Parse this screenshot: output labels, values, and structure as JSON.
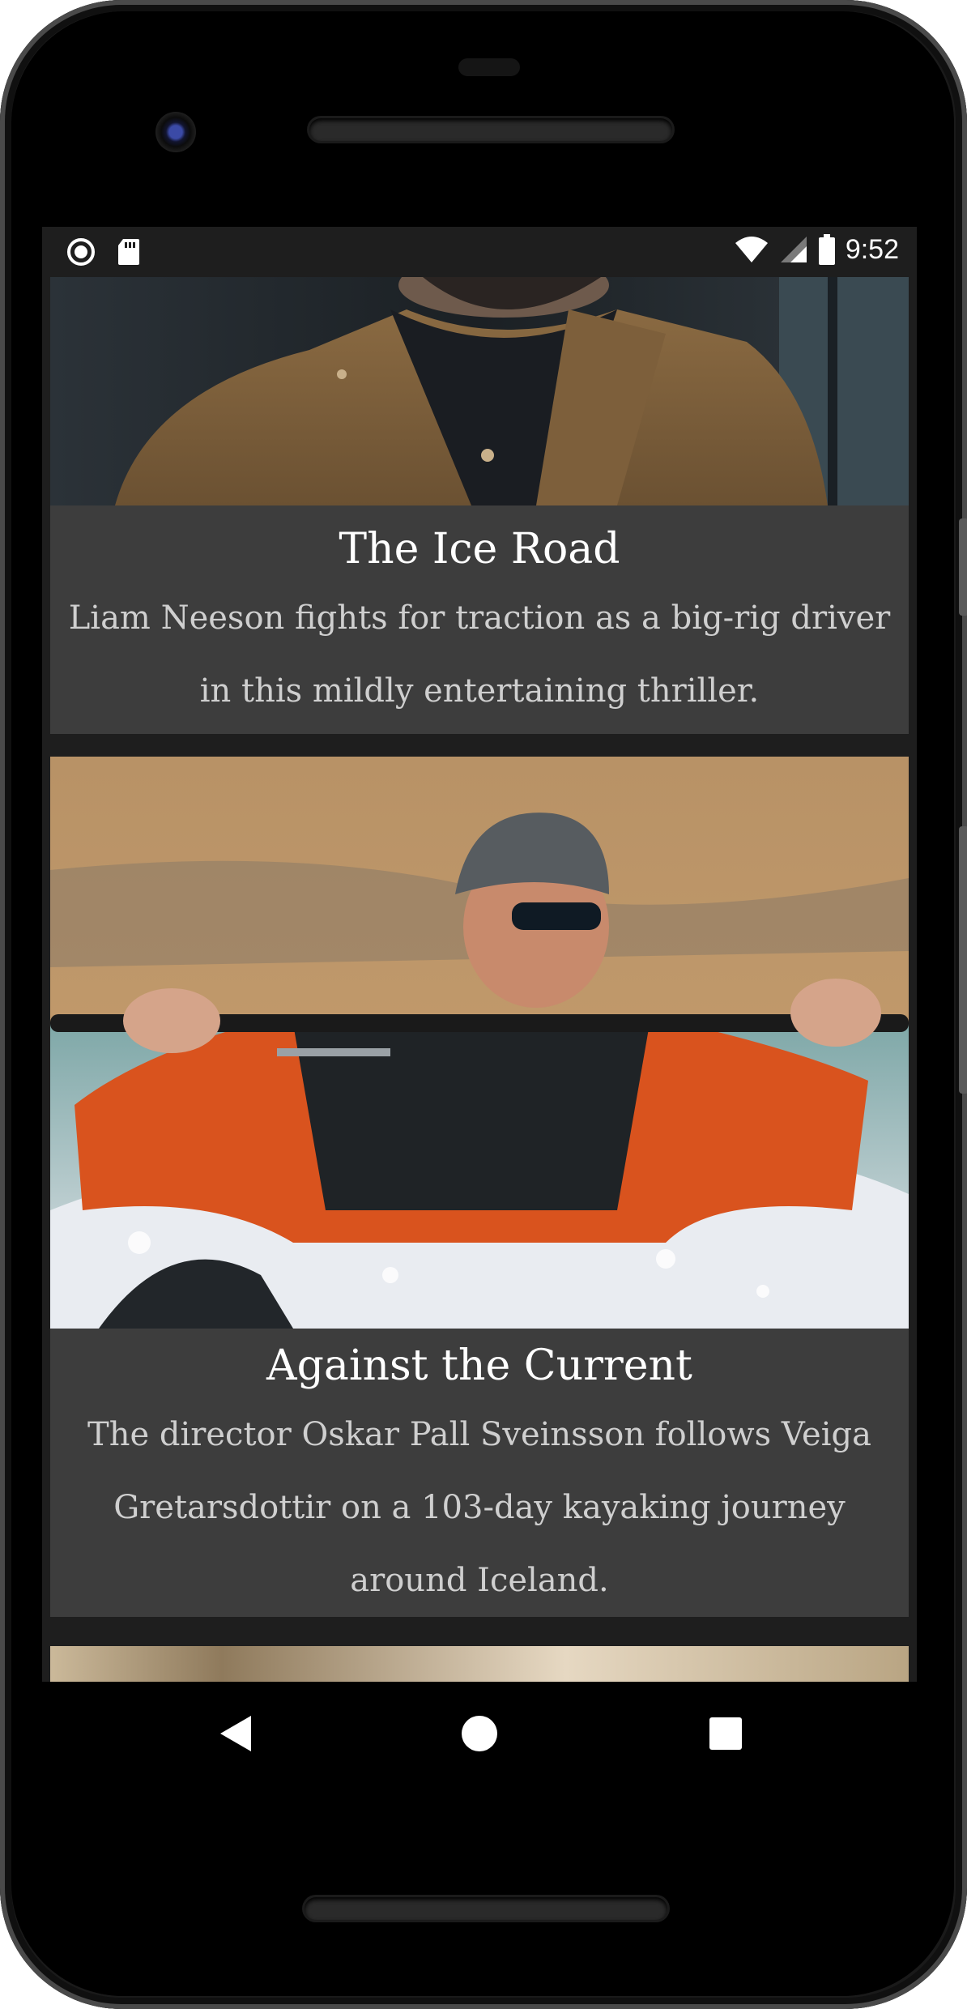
{
  "status_bar": {
    "time": "9:52",
    "icons": [
      "record-icon",
      "sd-card-icon",
      "wifi-icon",
      "signal-icon",
      "battery-icon"
    ]
  },
  "articles": [
    {
      "title": "The Ice Road",
      "description": "Liam Neeson fights for traction as a big-rig driver in this mildly entertaining thriller."
    },
    {
      "title": "Against the Current",
      "description": "The director Oskar Pall Sveinsson follows Veiga Gretarsdottir on a 103-day kayaking journey around Iceland."
    }
  ],
  "navigation": {
    "buttons": [
      "back-icon",
      "home-icon",
      "recents-icon"
    ]
  },
  "colors": {
    "card_background": "#3d3d3d",
    "title_text": "#ffffff",
    "description_text": "#cfcfcf"
  }
}
